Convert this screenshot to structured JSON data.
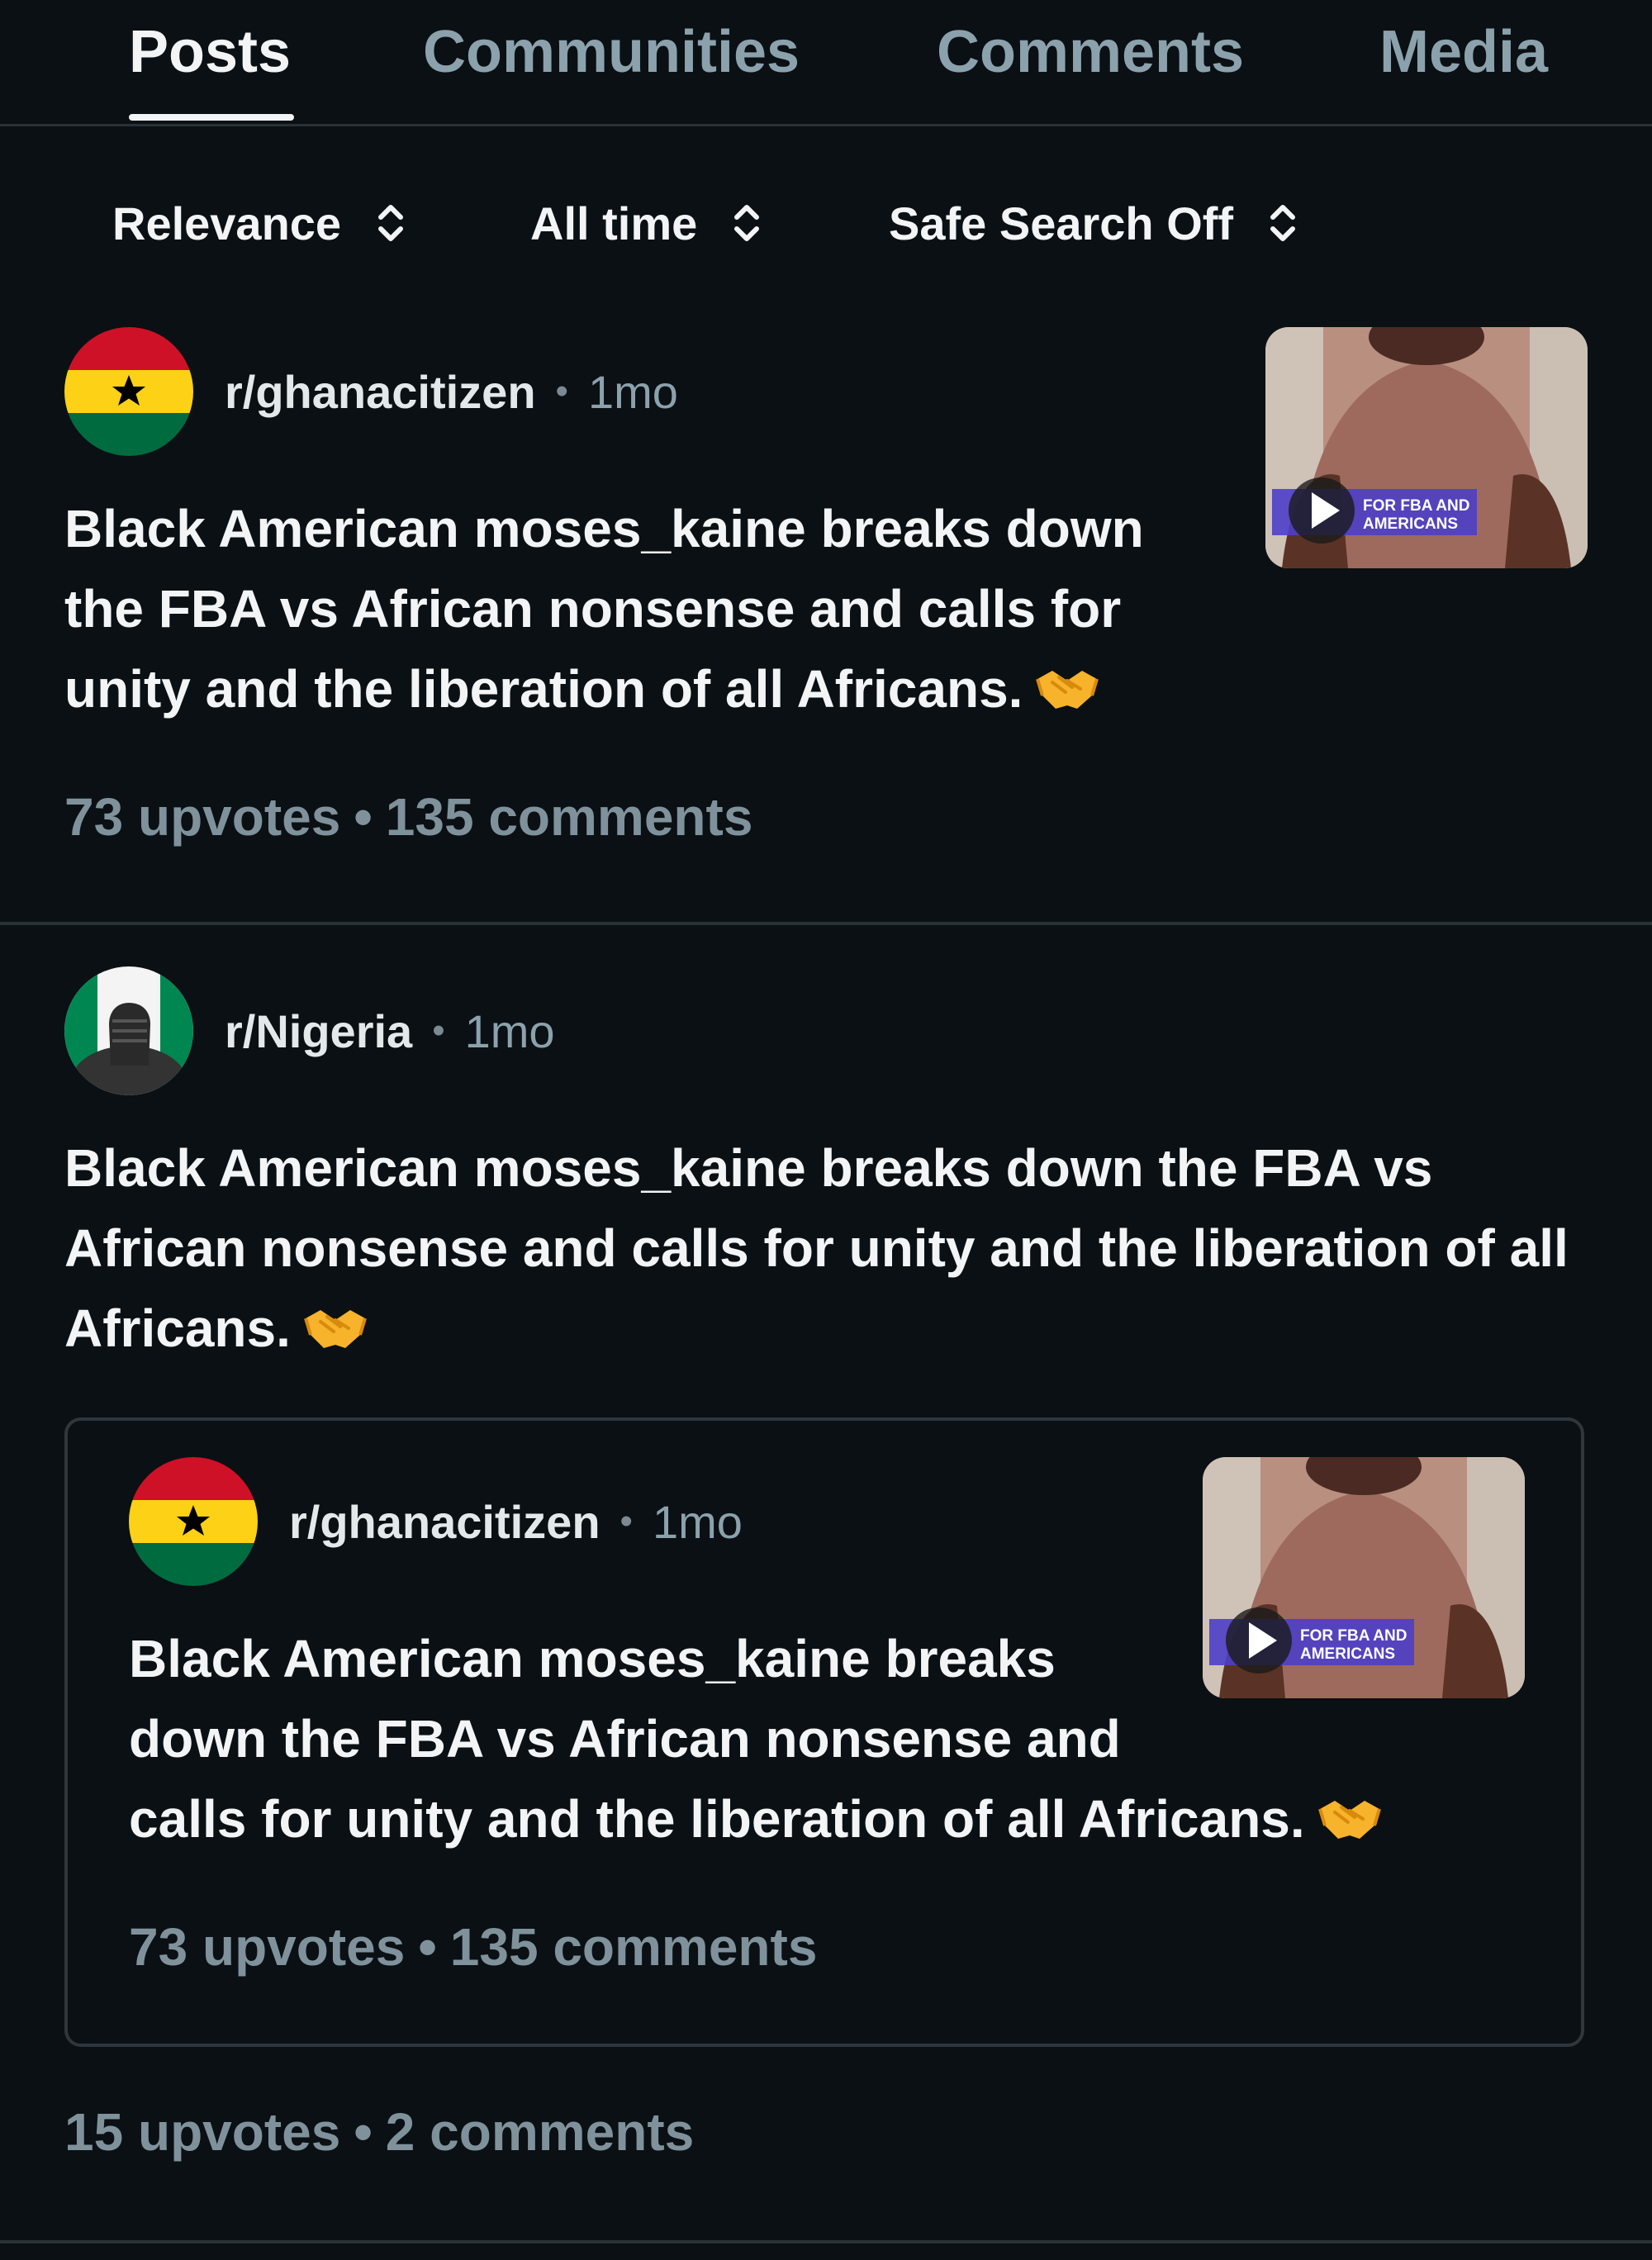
{
  "tabs": [
    {
      "label": "Posts",
      "active": true
    },
    {
      "label": "Communities",
      "active": false
    },
    {
      "label": "Comments",
      "active": false
    },
    {
      "label": "Media",
      "active": false
    }
  ],
  "filters": {
    "sort": "Relevance",
    "time": "All time",
    "safe_search": "Safe Search Off"
  },
  "posts": [
    {
      "subreddit": "r/ghanacitizen",
      "separator": "•",
      "age": "1mo",
      "title": "Black American moses_kaine breaks down the FBA vs African nonsense and calls for unity and the liberation of all Africans.",
      "title_lines": [
        "Black American moses_kaine breaks down",
        "the FBA vs African nonsense and calls for",
        "unity and the liberation of all Africans."
      ],
      "upvotes": "73 upvotes",
      "comments": "135 comments",
      "thumbnail_caption": [
        "FOR FBA AND",
        "AMERICANS"
      ]
    },
    {
      "subreddit": "r/Nigeria",
      "separator": "•",
      "age": "1mo",
      "title": "Black American moses_kaine breaks down the FBA vs African nonsense and calls for unity and the liberation of all Africans.",
      "title_lines": [
        "Black American moses_kaine breaks down the FBA vs",
        "African nonsense and calls for unity and the liberation of all",
        "Africans."
      ],
      "upvotes": "15 upvotes",
      "comments": "2 comments",
      "crosspost": {
        "subreddit": "r/ghanacitizen",
        "separator": "•",
        "age": "1mo",
        "title_lines": [
          "Black American moses_kaine breaks",
          "down the FBA vs African nonsense and",
          "calls for unity and the liberation of all Africans."
        ],
        "upvotes": "73 upvotes",
        "comments": "135 comments",
        "thumbnail_caption": [
          "FOR FBA AND",
          "AMERICANS"
        ]
      }
    }
  ],
  "meta_separator": "•",
  "icons": {
    "sort": "chevron-up-down-icon",
    "play": "play-icon",
    "emoji": "handshake-emoji",
    "ghana_avatar": "ghana-flag-icon",
    "nigeria_avatar": "nigeria-fist-icon"
  },
  "colors": {
    "background": "#0b1014",
    "text_primary": "#f2f4f5",
    "text_muted": "#7f929c",
    "divider": "#2b3236",
    "ghana_red": "#ce1126",
    "ghana_gold": "#fcd116",
    "ghana_green": "#006b3f",
    "nigeria_green": "#008751"
  }
}
